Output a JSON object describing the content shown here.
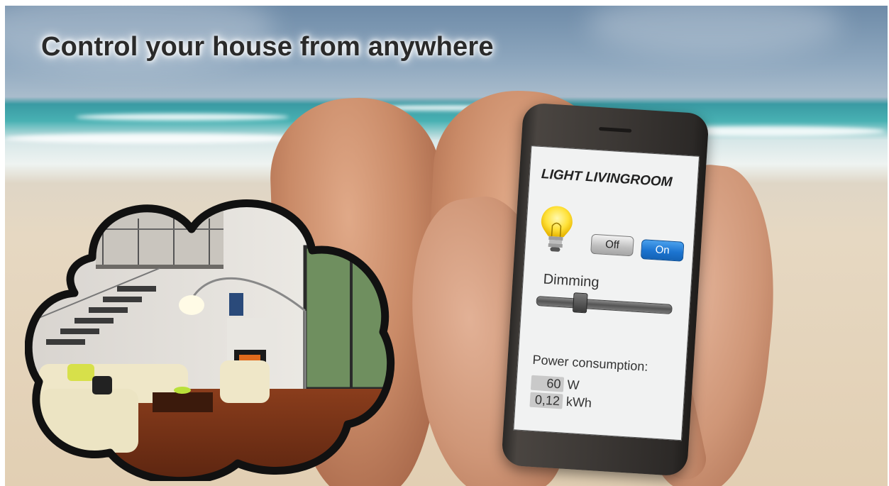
{
  "headline": "Control your house from anywhere",
  "phone": {
    "title": "LIGHT LIVINGROOM",
    "off_label": "Off",
    "on_label": "On",
    "state": "On",
    "dimming_label": "Dimming",
    "dimming_level": 0.3,
    "power_label": "Power consumption:",
    "power_value": "60",
    "power_unit": "W",
    "energy_value": "0,12",
    "energy_unit": "kWh"
  },
  "colors": {
    "on_button": "#1c74d0",
    "off_button": "#bdbdbd",
    "screen_bg": "#f1f2f2"
  },
  "icons": [
    "light-bulb-icon"
  ]
}
